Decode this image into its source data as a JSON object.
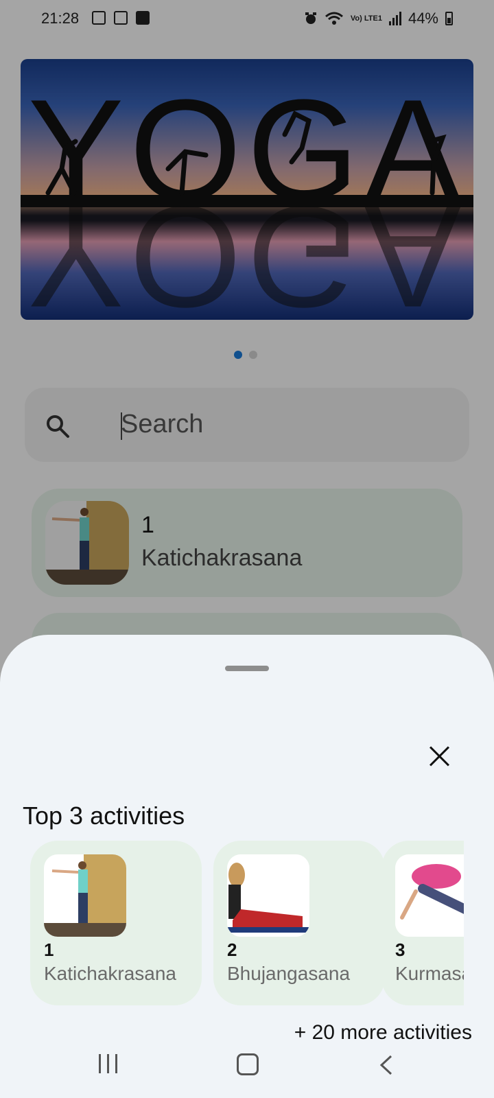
{
  "status_bar": {
    "time": "21:28",
    "battery": "44%",
    "network": "Vo) LTE1"
  },
  "carousel": {
    "banner_text": "YOGA",
    "page_count": 2,
    "active_page": 1
  },
  "search": {
    "placeholder": "Search"
  },
  "list": {
    "items": [
      {
        "number": "1",
        "name": "Katichakrasana"
      }
    ]
  },
  "sheet": {
    "title": "Top 3 activities",
    "activities": [
      {
        "number": "1",
        "name": "Katichakrasana"
      },
      {
        "number": "2",
        "name": "Bhujangasana"
      },
      {
        "number": "3",
        "name": "Kurmasana"
      }
    ],
    "more_link": "+ 20 more activities"
  },
  "colors": {
    "accent": "#1a7ad8",
    "card_bg": "#e6f1e8",
    "sheet_bg": "#f0f4f8"
  }
}
